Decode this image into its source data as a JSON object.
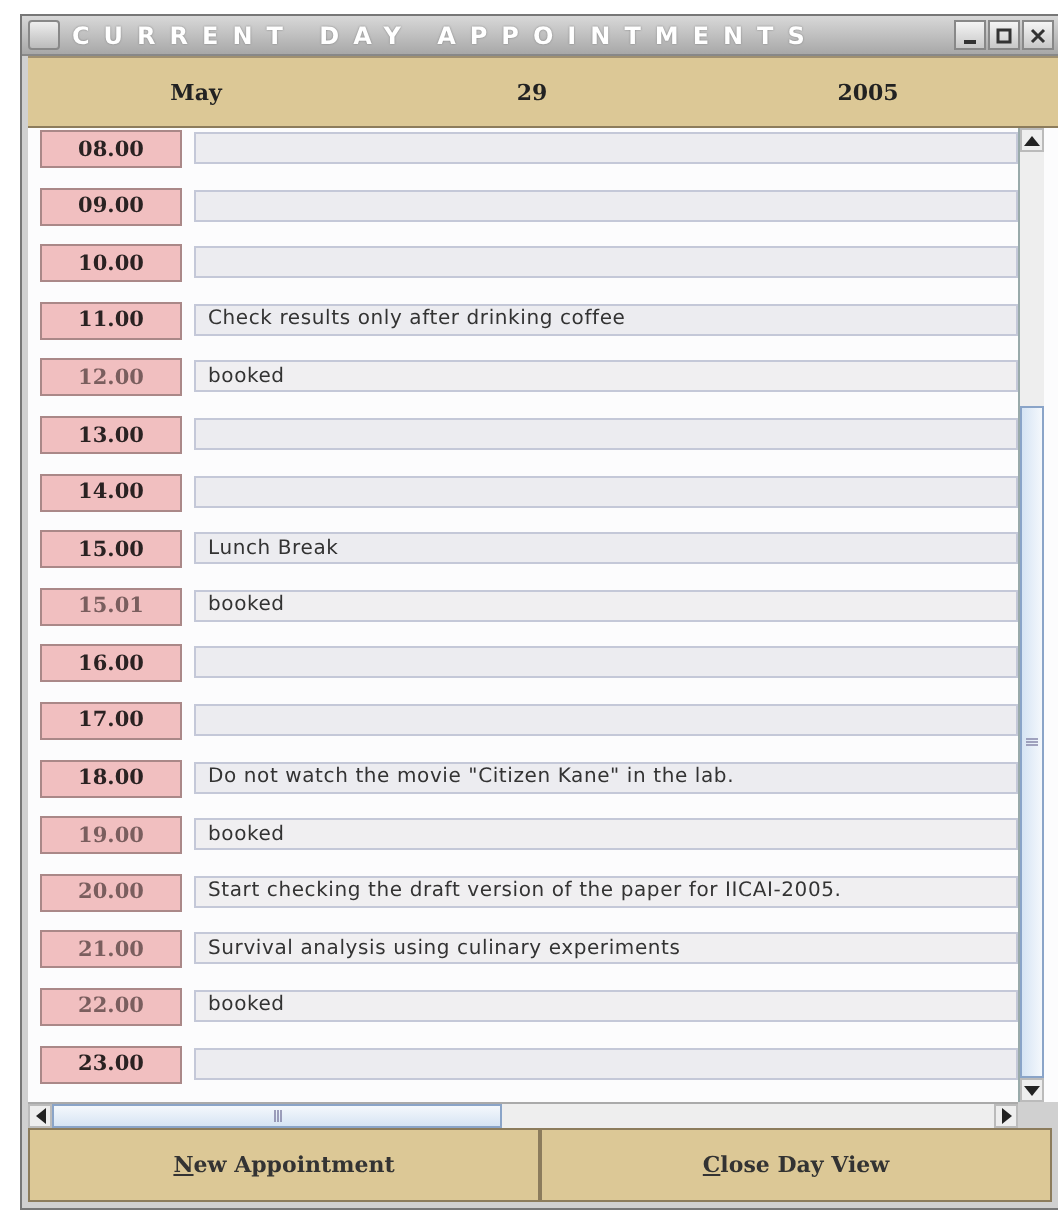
{
  "window": {
    "title": "CURRENT DAY APPOINTMENTS"
  },
  "date": {
    "month": "May",
    "day": "29",
    "year": "2005"
  },
  "slots": [
    {
      "time": "08.00",
      "disabled": false
    },
    {
      "time": "09.00",
      "disabled": false
    },
    {
      "time": "10.00",
      "disabled": false
    },
    {
      "time": "11.00",
      "entry": "Check results only after drinking coffee",
      "disabled": false
    },
    {
      "time": "12.00",
      "entry": "booked",
      "disabled": true
    },
    {
      "time": "13.00",
      "disabled": false
    },
    {
      "time": "14.00",
      "disabled": false
    },
    {
      "time": "15.00",
      "entry": "Lunch Break",
      "disabled": false
    },
    {
      "time": "15.01",
      "entry": "booked",
      "disabled": true
    },
    {
      "time": "16.00",
      "disabled": false
    },
    {
      "time": "17.00",
      "disabled": false
    },
    {
      "time": "18.00",
      "entry": "Do not watch the movie \"Citizen Kane\" in the lab.",
      "disabled": false
    },
    {
      "time": "19.00",
      "entry": "booked",
      "disabled": true
    },
    {
      "time": "20.00",
      "entry": "Start checking the draft version of the paper for IICAI-2005.",
      "disabled": true
    },
    {
      "time": "21.00",
      "entry": "Survival analysis using culinary experiments",
      "disabled": true
    },
    {
      "time": "22.00",
      "entry": "booked",
      "disabled": true
    },
    {
      "time": "23.00",
      "disabled": false
    }
  ],
  "buttons": [
    "New Appointment",
    "Close Day View"
  ]
}
